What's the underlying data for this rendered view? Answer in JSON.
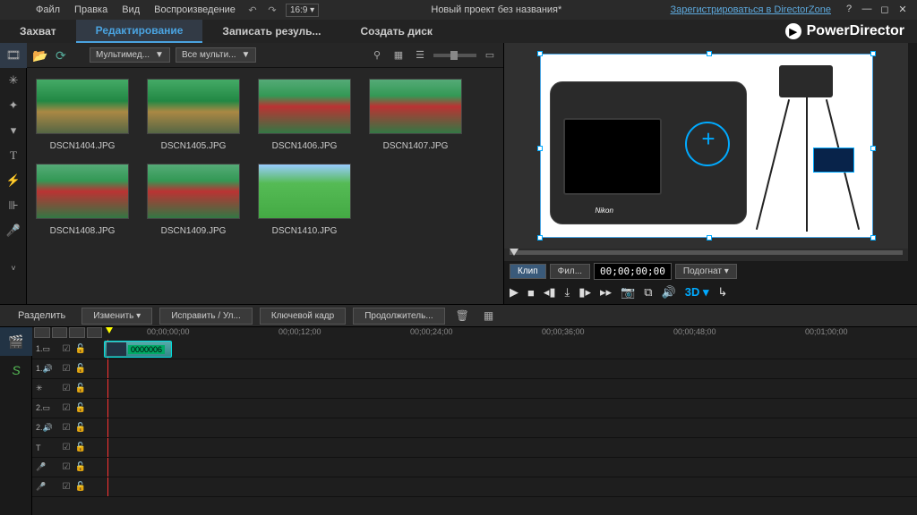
{
  "menu": {
    "file": "Файл",
    "edit": "Правка",
    "view": "Вид",
    "playback": "Воспроизведение"
  },
  "zoom": "16:9",
  "project_title": "Новый проект без названия*",
  "director_zone_link": "Зарегистрироваться в DirectorZone",
  "brand": "PowerDirector",
  "tabs": {
    "capture": "Захват",
    "edit": "Редактирование",
    "produce": "Записать резуль...",
    "disc": "Создать диск"
  },
  "lib_dropdown1": "Мультимед...",
  "lib_dropdown2": "Все мульти...",
  "thumbs": [
    {
      "label": "DSCN1404.JPG"
    },
    {
      "label": "DSCN1405.JPG"
    },
    {
      "label": "DSCN1406.JPG"
    },
    {
      "label": "DSCN1407.JPG"
    },
    {
      "label": "DSCN1408.JPG"
    },
    {
      "label": "DSCN1409.JPG"
    },
    {
      "label": "DSCN1410.JPG"
    }
  ],
  "preview": {
    "btn_clip": "Клип",
    "btn_film": "Фил...",
    "timecode": "00;00;00;00",
    "fit": "Подогнат",
    "cam_brand": "Nikon"
  },
  "edit_toolbar": {
    "split": "Разделить",
    "modify": "Изменить",
    "fix": "Исправить / Ул...",
    "keyframe": "Ключевой кадр",
    "duration": "Продолжитель..."
  },
  "ruler": [
    "00;00;00;00",
    "00;00;12;00",
    "00;00;24;00",
    "00;00;36;00",
    "00;00;48;00",
    "00;01;00;00"
  ],
  "tracks": [
    "1.▭",
    "1.🔊",
    "✳",
    "2.▭",
    "2.🔊",
    "T",
    "🎤",
    "🎤"
  ],
  "clip_label": "0000006"
}
